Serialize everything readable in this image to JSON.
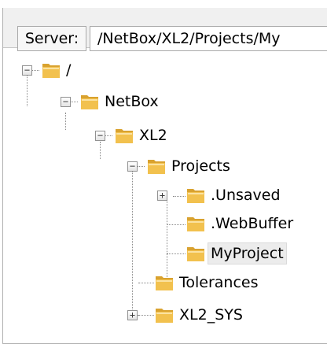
{
  "server": {
    "label": "Server:",
    "path": "/NetBox/XL2/Projects/My"
  },
  "tree": {
    "root": {
      "label": "/",
      "expander": "−"
    },
    "netbox": {
      "label": "NetBox",
      "expander": "−"
    },
    "xl2": {
      "label": "XL2",
      "expander": "−"
    },
    "projects": {
      "label": "Projects",
      "expander": "−"
    },
    "unsaved": {
      "label": ".Unsaved",
      "expander": "+"
    },
    "webbuffer": {
      "label": ".WebBuffer"
    },
    "myproject": {
      "label": "MyProject",
      "selected": true
    },
    "tolerances": {
      "label": "Tolerances"
    },
    "xl2sys": {
      "label": "XL2_SYS",
      "expander": "+"
    }
  },
  "colors": {
    "folder_front": "#f2c14e",
    "folder_back": "#d9a22f",
    "selection": "#ececec"
  }
}
